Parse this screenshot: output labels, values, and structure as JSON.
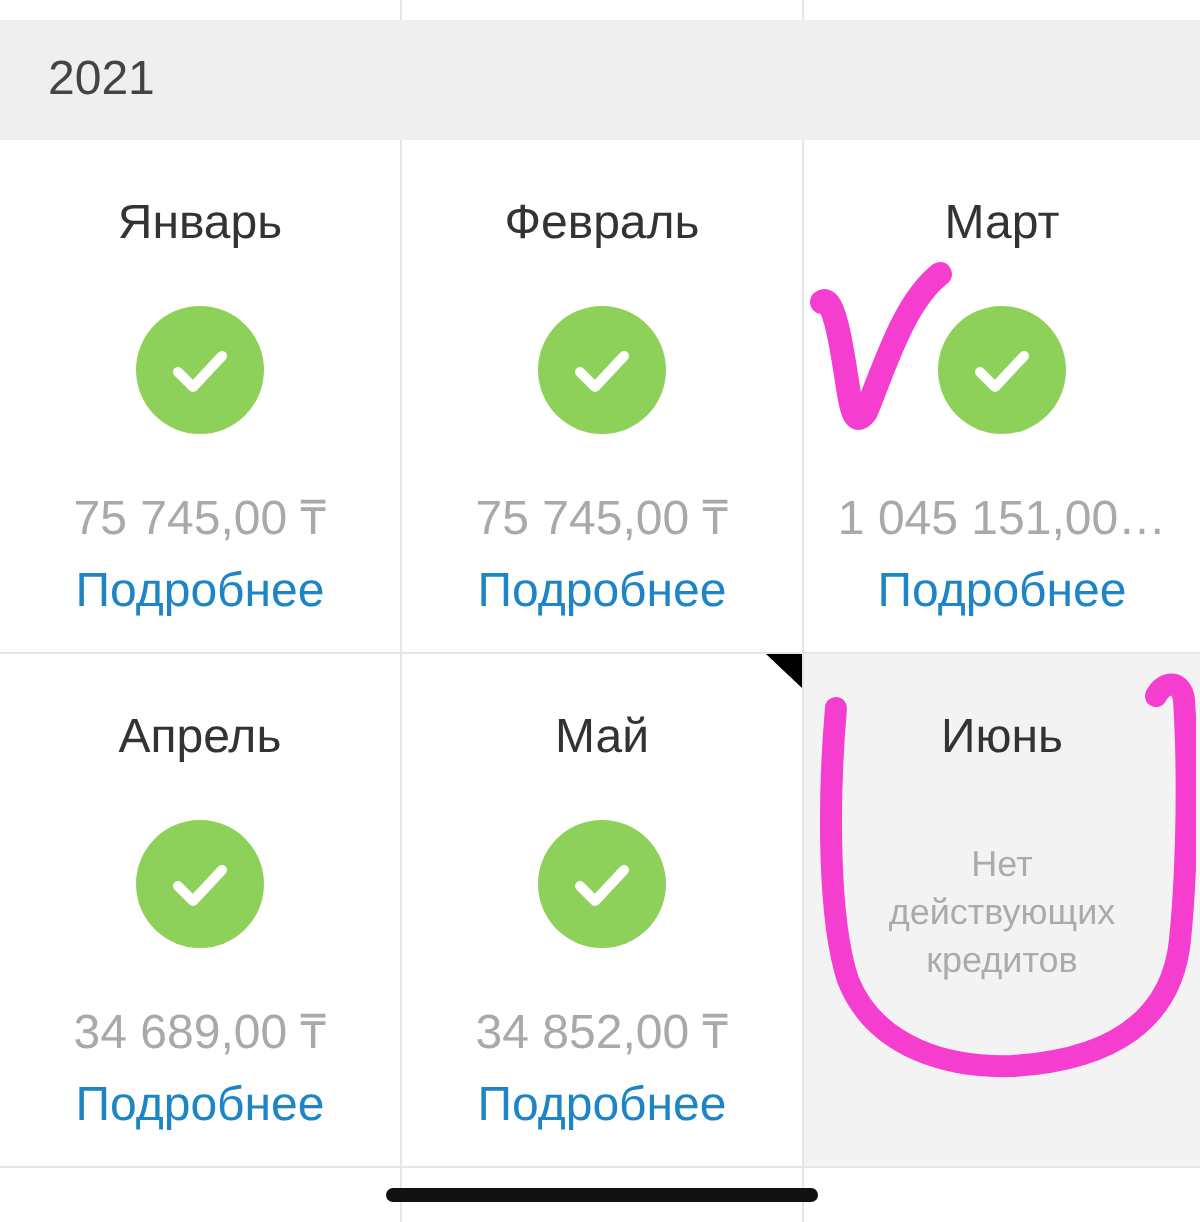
{
  "year_header": {
    "title": "2021"
  },
  "months": [
    {
      "kind": "paid",
      "name": "Январь",
      "amount": "75 745,00 ₸",
      "link": "Подробнее",
      "corner_mark": false
    },
    {
      "kind": "paid",
      "name": "Февраль",
      "amount": "75 745,00 ₸",
      "link": "Подробнее",
      "corner_mark": false
    },
    {
      "kind": "paid",
      "name": "Март",
      "amount": "1 045 151,00…",
      "link": "Подробнее",
      "corner_mark": false
    },
    {
      "kind": "paid",
      "name": "Апрель",
      "amount": "34 689,00 ₸",
      "link": "Подробнее",
      "corner_mark": false
    },
    {
      "kind": "paid",
      "name": "Май",
      "amount": "34 852,00 ₸",
      "link": "Подробнее",
      "corner_mark": true
    },
    {
      "kind": "no_credits",
      "name": "Июнь",
      "message": "Нет действующих кредитов",
      "corner_mark": false
    }
  ]
}
